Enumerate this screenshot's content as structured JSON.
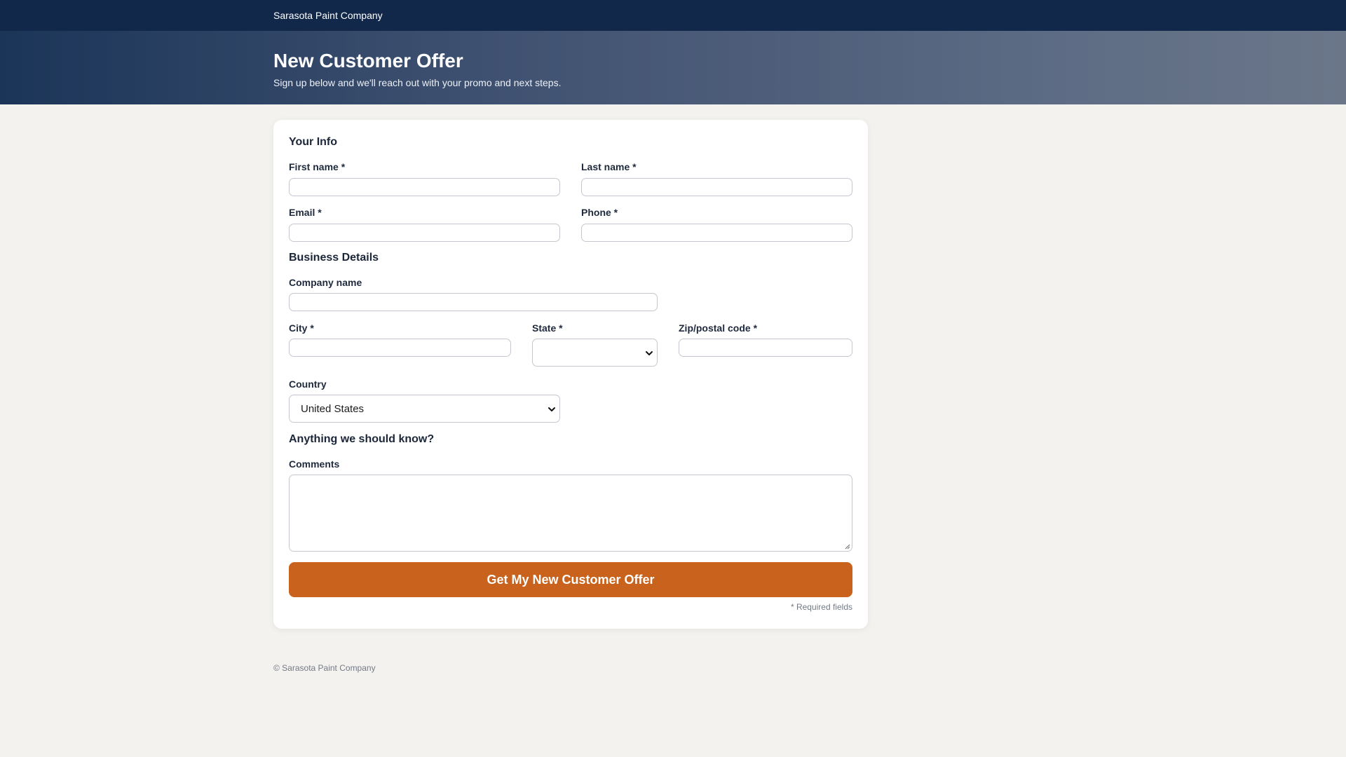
{
  "topbar": {
    "company": "Sarasota Paint Company"
  },
  "hero": {
    "title": "New Customer Offer",
    "subtitle": "Sign up below and we'll reach out with your promo and next steps."
  },
  "form": {
    "your_info": {
      "title": "Your Info",
      "first_name_label": "First name *",
      "first_name_value": "",
      "last_name_label": "Last name *",
      "last_name_value": "",
      "email_label": "Email *",
      "email_value": "",
      "phone_label": "Phone *",
      "phone_value": ""
    },
    "business": {
      "title": "Business Details",
      "company_label": "Company name",
      "company_value": "",
      "city_label": "City *",
      "city_value": "",
      "state_label": "State *",
      "state_value": "",
      "zip_label": "Zip/postal code *",
      "zip_value": "",
      "country_label": "Country",
      "country_value": "United States"
    },
    "extra": {
      "title": "Anything we should know?",
      "comments_label": "Comments",
      "comments_value": ""
    },
    "submit_label": "Get My New Customer Offer",
    "required_note": "* Required fields"
  },
  "footer": {
    "copyright": "© Sarasota Paint Company"
  },
  "colors": {
    "topbar": "#12284a",
    "accent_button": "#c8621c",
    "page_background": "#f4f2ee"
  },
  "icons": {
    "select_arrow": "chevron-down-icon",
    "textarea_resize": "resize-grip-icon"
  }
}
